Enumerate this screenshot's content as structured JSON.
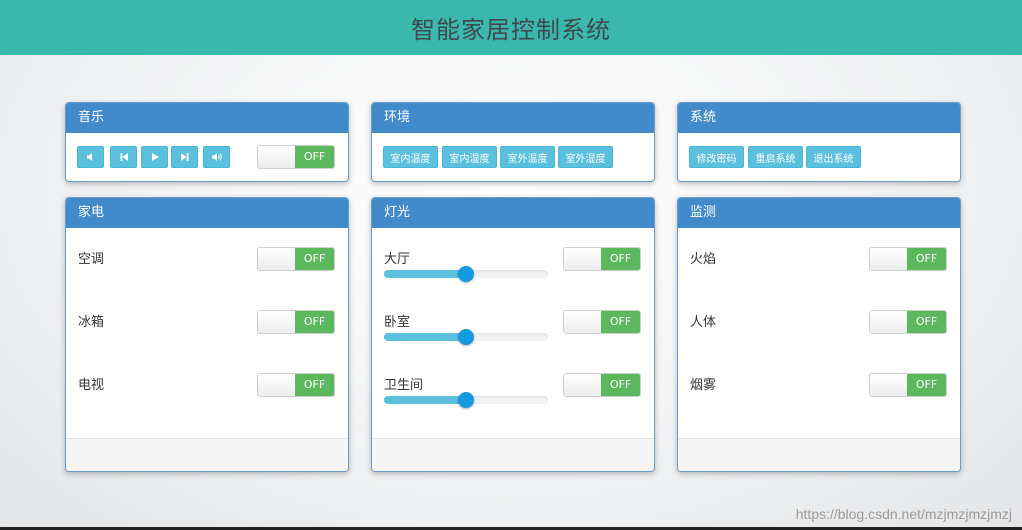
{
  "title": "智能家居控制系统",
  "music": {
    "title": "音乐",
    "buttons": [
      "volume-down-icon",
      "step-backward-icon",
      "play-icon",
      "step-forward-icon",
      "volume-up-icon"
    ],
    "switch_label": "OFF"
  },
  "environment": {
    "title": "环境",
    "buttons": [
      "室内温度",
      "室内湿度",
      "室外温度",
      "室外湿度"
    ]
  },
  "system": {
    "title": "系统",
    "buttons": [
      "修改密码",
      "重启系统",
      "退出系统"
    ]
  },
  "appliances": {
    "title": "家电",
    "items": [
      {
        "label": "空调",
        "state": "OFF"
      },
      {
        "label": "冰箱",
        "state": "OFF"
      },
      {
        "label": "电视",
        "state": "OFF"
      }
    ]
  },
  "lights": {
    "title": "灯光",
    "items": [
      {
        "label": "大厅",
        "state": "OFF",
        "level": 50
      },
      {
        "label": "卧室",
        "state": "OFF",
        "level": 50
      },
      {
        "label": "卫生间",
        "state": "OFF",
        "level": 50
      }
    ]
  },
  "monitoring": {
    "title": "监测",
    "items": [
      {
        "label": "火焰",
        "state": "OFF"
      },
      {
        "label": "人体",
        "state": "OFF"
      },
      {
        "label": "烟雾",
        "state": "OFF"
      }
    ]
  },
  "watermark": "https://blog.csdn.net/mzjmzjmzjmzj",
  "colors": {
    "header": "#3bb8ad",
    "panel_head": "#428bca",
    "info_button": "#5bc0de",
    "switch_off": "#5cb85c",
    "slider_handle": "#149bdf"
  }
}
